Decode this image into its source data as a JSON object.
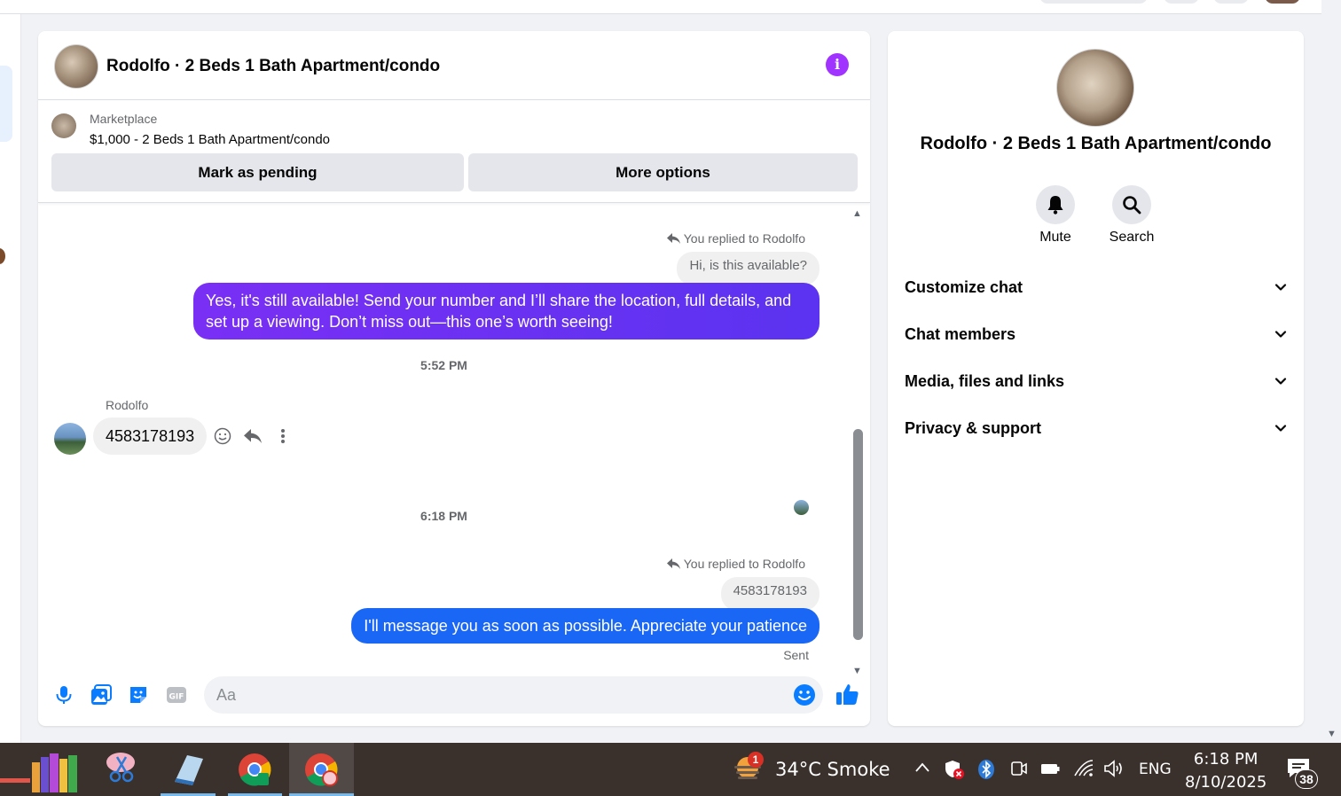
{
  "chat": {
    "title": "Rodolfo · 2 Beds 1 Bath Apartment/condo",
    "info_icon": "info-icon",
    "listing": {
      "source": "Marketplace",
      "price_title": "$1,000 - 2 Beds 1 Bath Apartment/condo",
      "mark_pending_label": "Mark as pending",
      "more_options_label": "More options"
    },
    "messages": {
      "reply_note_1": "You replied to Rodolfo",
      "quoted_1": "Hi, is this available?",
      "outgoing_1_line1": "Yes, it's still available! Send your number and I’ll share the location, full details, and",
      "outgoing_1_line2": "set up a viewing. Don’t miss out—this one’s worth seeing!",
      "time_1": "5:52 PM",
      "sender_name": "Rodolfo",
      "incoming_1": "4583178193",
      "time_2": "6:18 PM",
      "reply_note_2": "You replied to Rodolfo",
      "quoted_2": "4583178193",
      "outgoing_2": "I'll message you as soon as possible. Appreciate your patience",
      "status": "Sent"
    },
    "composer": {
      "placeholder": "Aa"
    },
    "accent_purple": "#7a2ff5",
    "accent_blue": "#1a66f5"
  },
  "info_panel": {
    "title": "Rodolfo · 2 Beds 1 Bath Apartment/condo",
    "mute_label": "Mute",
    "search_label": "Search",
    "sections": [
      {
        "label": "Customize chat"
      },
      {
        "label": "Chat members"
      },
      {
        "label": "Media, files and links"
      },
      {
        "label": "Privacy & support"
      }
    ]
  },
  "taskbar": {
    "weather_badge": "1",
    "weather": "34°C  Smoke",
    "language": "ENG",
    "time": "6:18 PM",
    "date": "8/10/2025",
    "notifications": "38"
  }
}
